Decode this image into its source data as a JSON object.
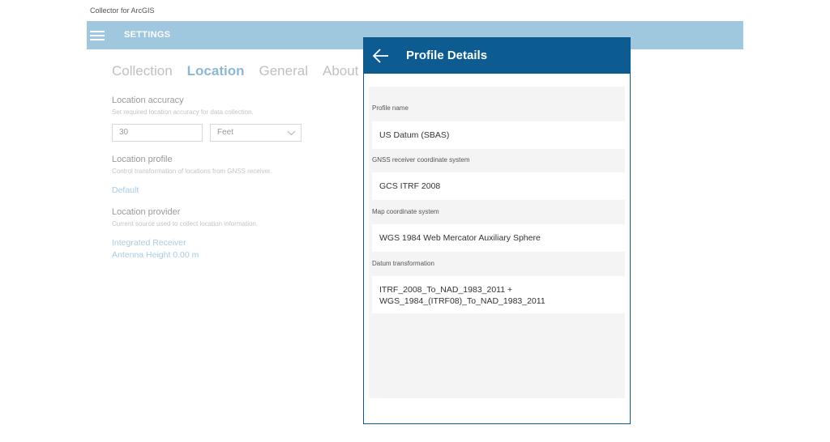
{
  "app": {
    "title": "Collector for ArcGIS"
  },
  "header": {
    "title": "SETTINGS"
  },
  "tabs": [
    {
      "label": "Collection",
      "active": false
    },
    {
      "label": "Location",
      "active": true
    },
    {
      "label": "General",
      "active": false
    },
    {
      "label": "About",
      "active": false
    }
  ],
  "settings": {
    "accuracy": {
      "title": "Location accuracy",
      "description": "Set required location accuracy for data collection.",
      "value": "30",
      "unit": "Feet"
    },
    "profile": {
      "title": "Location profile",
      "description": "Control transformation of locations from GNSS receiver.",
      "value": "Default"
    },
    "provider": {
      "title": "Location provider",
      "description": "Current source used to collect location information.",
      "value_line1": "Integrated Receiver",
      "value_line2": "Antenna Height 0.00 m"
    }
  },
  "modal": {
    "title": "Profile Details",
    "fields": {
      "profile_name": {
        "label": "Profile name",
        "value": "US Datum (SBAS)"
      },
      "gnss_cs": {
        "label": "GNSS receiver coordinate system",
        "value": "GCS ITRF 2008"
      },
      "map_cs": {
        "label": "Map coordinate system",
        "value": "WGS 1984 Web Mercator Auxiliary Sphere"
      },
      "datum": {
        "label": "Datum transformation",
        "value_line1": "ITRF_2008_To_NAD_1983_2011 +",
        "value_line2": "WGS_1984_(ITRF08)_To_NAD_1983_2011"
      }
    }
  },
  "colors": {
    "header_bar": "#9fc7dd",
    "modal_header": "#0c5b91",
    "active_tab": "#8ab8d5",
    "link": "#a9cbe0"
  },
  "icons": {
    "menu": "hamburger-menu-icon",
    "back": "back-arrow-icon",
    "dropdown": "chevron-down-icon"
  }
}
